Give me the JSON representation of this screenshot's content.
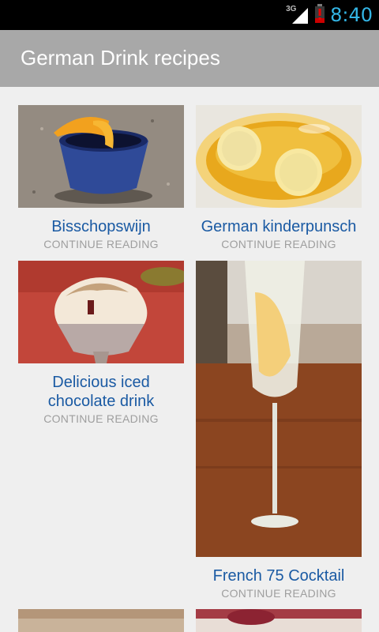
{
  "status_bar": {
    "network": "3G",
    "time": "8:40"
  },
  "action_bar": {
    "title": "German Drink recipes"
  },
  "recipes": [
    {
      "title": "Bisschopswijn",
      "cta": "CONTINUE READING"
    },
    {
      "title": "German kinderpunsch",
      "cta": "CONTINUE READING"
    },
    {
      "title": "Delicious iced chocolate drink",
      "cta": "CONTINUE READING"
    },
    {
      "title": "French 75 Cocktail",
      "cta": "CONTINUE READING"
    }
  ],
  "colors": {
    "title_link": "#1a5aa3",
    "status_time": "#33b5e5",
    "action_bar": "#a8a8a8"
  }
}
